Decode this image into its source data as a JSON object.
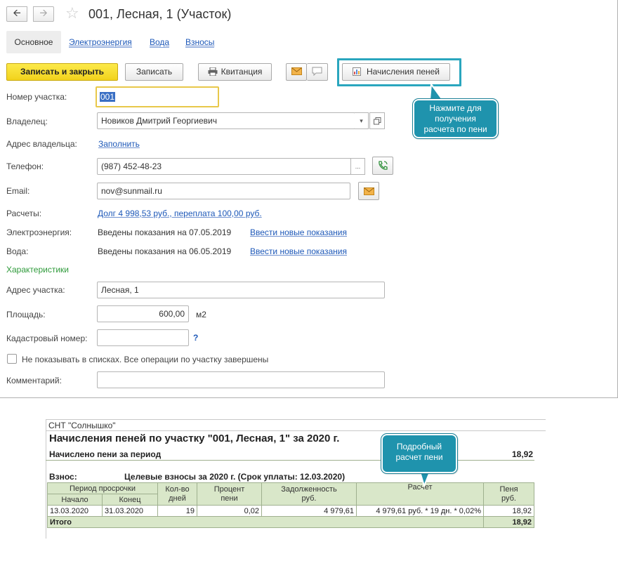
{
  "window": {
    "title": "001, Лесная, 1 (Участок)"
  },
  "tabs": [
    {
      "label": "Основное"
    },
    {
      "label": "Электроэнергия"
    },
    {
      "label": "Вода"
    },
    {
      "label": "Взносы"
    }
  ],
  "toolbar": {
    "save_close_label": "Записать и закрыть",
    "save_label": "Записать",
    "receipt_label": "Квитанция",
    "penalties_label": "Начисления пеней"
  },
  "callouts": {
    "top": [
      "Нажмите для",
      "получения",
      "расчета по пени"
    ],
    "bottom": [
      "Подробный",
      "расчет пени"
    ]
  },
  "form": {
    "plot_number": {
      "label": "Номер участка:",
      "value": "001"
    },
    "owner": {
      "label": "Владелец:",
      "value": "Новиков Дмитрий Георгиевич"
    },
    "owner_address": {
      "label": "Адрес владельца:",
      "link": "Заполнить"
    },
    "phone": {
      "label": "Телефон:",
      "value": "(987) 452-48-23"
    },
    "email": {
      "label": "Email:",
      "value": "nov@sunmail.ru"
    },
    "settlements": {
      "label": "Расчеты:",
      "link": "Долг 4 998,53 руб., переплата 100,00 руб."
    },
    "electricity": {
      "label": "Электроэнергия:",
      "text": "Введены показания на 07.05.2019",
      "link": "Ввести новые показания"
    },
    "water": {
      "label": "Вода:",
      "text": "Введены показания на 06.05.2019",
      "link": "Ввести новые показания"
    },
    "section_title": "Характеристики",
    "plot_address": {
      "label": "Адрес участка:",
      "value": "Лесная, 1"
    },
    "area": {
      "label": "Площадь:",
      "value": "600,00",
      "unit": "м2"
    },
    "cadastral": {
      "label": "Кадастровый номер:",
      "value": "",
      "help": "?"
    },
    "hide_checkbox": {
      "label": "Не показывать в списках. Все операции по участку завершены",
      "checked": false
    },
    "comment": {
      "label": "Комментарий:",
      "value": ""
    }
  },
  "report": {
    "org": "СНТ \"Солнышко\"",
    "title": "Начисления пеней по участку \"001, Лесная, 1\"  за 2020 г.",
    "accrued_label": "Начислено пени за период",
    "accrued_value": "18,92",
    "fee_label": "Взнос:",
    "fee_value": "Целевые взносы за 2020 г. (Срок уплаты: 12.03.2020)",
    "headers": {
      "period": "Период просрочки",
      "start": "Начало",
      "end": "Конец",
      "days": [
        "Кол-во",
        "дней"
      ],
      "percent": [
        "Процент",
        "пени"
      ],
      "debt": [
        "Задолженность",
        "руб."
      ],
      "calc": "Расчет",
      "penalty": [
        "Пеня",
        "руб."
      ]
    },
    "rows": [
      {
        "start": "13.03.2020",
        "end": "31.03.2020",
        "days": "19",
        "percent": "0,02",
        "debt": "4 979,61",
        "calc": "4 979,61 руб. * 19 дн. * 0,02%",
        "penalty": "18,92"
      }
    ],
    "total_label": "Итого",
    "total_value": "18,92"
  }
}
